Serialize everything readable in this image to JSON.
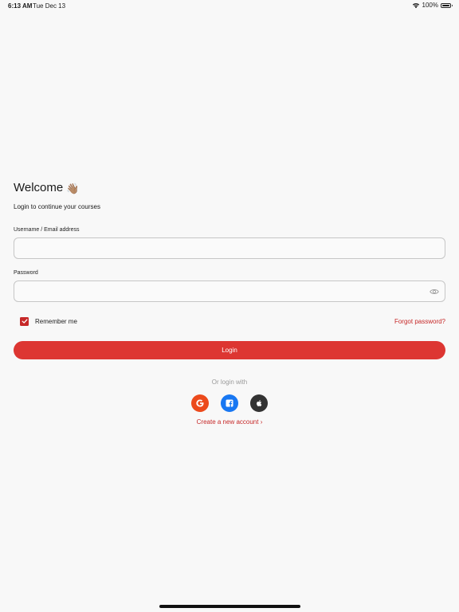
{
  "status_bar": {
    "time": "6:13 AM",
    "date": "Tue Dec 13",
    "battery_percent": "100%",
    "battery_level": 1.0,
    "icons": [
      "wifi-icon",
      "battery-icon"
    ]
  },
  "login": {
    "title": "Welcome",
    "title_emoji": "👋🏽",
    "subtitle": "Login to continue your courses",
    "username_label": "Username / Email address",
    "username_value": "",
    "password_label": "Password",
    "password_value": "",
    "remember_label": "Remember me",
    "remember_checked": true,
    "forgot_label": "Forgot password?",
    "login_button": "Login",
    "or_text": "Or login with",
    "social": [
      "google-icon",
      "facebook-icon",
      "apple-icon"
    ],
    "create_account": "Create a new account ›"
  },
  "colors": {
    "accent": "#dd3632",
    "link": "#c62828",
    "background": "#f8f8f8",
    "google": "#ec4a1c",
    "facebook": "#1877f2",
    "apple": "#333333"
  }
}
